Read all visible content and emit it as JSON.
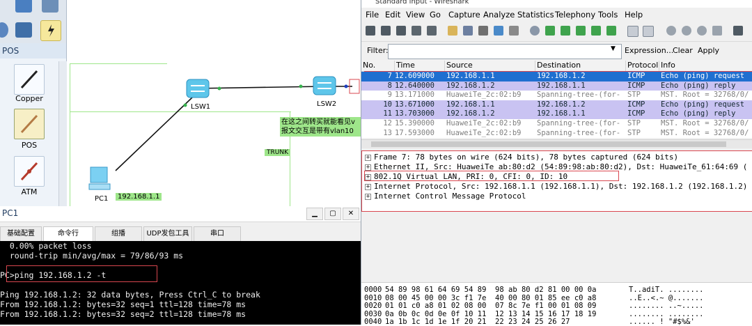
{
  "ensp": {
    "device_panel": {
      "category_title": "POS",
      "devices": [
        {
          "label": "Copper",
          "icon": "copper-cable-icon"
        },
        {
          "label": "POS",
          "icon": "pos-cable-icon"
        },
        {
          "label": "ATM",
          "icon": "atm-cable-icon"
        }
      ]
    },
    "topology": {
      "lsw1_label": "LSW1",
      "lsw2_label": "LSW2",
      "pc1_label": "PC1",
      "pc1_ip": "192.168.1.1",
      "trunk_label": "TRUNK",
      "note_line1": "在这之间转买就能看见v",
      "note_line2": "报文交互是带有vlan10"
    },
    "pc1_window": {
      "title": "PC1",
      "tabs": [
        "基础配置",
        "命令行",
        "组播",
        "UDP发包工具",
        "串口"
      ],
      "active_tab": "命令行",
      "console_lines": [
        "  0.00% packet loss",
        "  round-trip min/avg/max = 79/86/93 ms",
        "",
        "PC>ping 192.168.1.2 -t",
        "",
        "Ping 192.168.1.2: 32 data bytes, Press Ctrl_C to break",
        "From 192.168.1.2: bytes=32 seq=1 ttl=128 time=78 ms",
        "From 192.168.1.2: bytes=32 seq=2 ttl=128 time=78 ms"
      ]
    }
  },
  "wireshark": {
    "title": "Standard input - Wireshark",
    "menu": [
      "File",
      "Edit",
      "View",
      "Go",
      "Capture",
      "Analyze",
      "Statistics",
      "Telephony",
      "Tools",
      "Help"
    ],
    "filter": {
      "label": "Filter:",
      "value": "",
      "expression_label": "Expression...",
      "clear_label": "Clear",
      "apply_label": "Apply"
    },
    "columns": [
      "No.",
      "Time",
      "Source",
      "Destination",
      "Protocol",
      "Info"
    ],
    "packets": [
      {
        "no": "7",
        "time": "12.609000",
        "src": "192.168.1.1",
        "dst": "192.168.1.2",
        "proto": "ICMP",
        "info": "Echo (ping) request",
        "style": "selected"
      },
      {
        "no": "8",
        "time": "12.640000",
        "src": "192.168.1.2",
        "dst": "192.168.1.1",
        "proto": "ICMP",
        "info": "Echo (ping) reply",
        "style": "icmp"
      },
      {
        "no": "9",
        "time": "13.171000",
        "src": "HuaweiTe_2c:02:b9",
        "dst": "Spanning-tree-(for-",
        "proto": "STP",
        "info": "MST. Root = 32768/0/",
        "style": "stp"
      },
      {
        "no": "10",
        "time": "13.671000",
        "src": "192.168.1.1",
        "dst": "192.168.1.2",
        "proto": "ICMP",
        "info": "Echo (ping) request",
        "style": "icmp"
      },
      {
        "no": "11",
        "time": "13.703000",
        "src": "192.168.1.2",
        "dst": "192.168.1.1",
        "proto": "ICMP",
        "info": "Echo (ping) reply",
        "style": "icmp"
      },
      {
        "no": "12",
        "time": "15.390000",
        "src": "HuaweiTe_2c:02:b9",
        "dst": "Spanning-tree-(for-",
        "proto": "STP",
        "info": "MST. Root = 32768/0/",
        "style": "stp"
      },
      {
        "no": "13",
        "time": "17.593000",
        "src": "HuaweiTe_2c:02:b9",
        "dst": "Spanning-tree-(for-",
        "proto": "STP",
        "info": "MST. Root = 32768/0/",
        "style": "stp"
      }
    ],
    "details": [
      "Frame 7: 78 bytes on wire (624 bits), 78 bytes captured (624 bits)",
      "Ethernet II, Src: HuaweiTe_ab:80:d2 (54:89:98:ab:80:d2), Dst: HuaweiTe_61:64:69 (",
      "802.1Q Virtual LAN, PRI: 0, CFI: 0, ID: 10",
      "Internet Protocol, Src: 192.168.1.1 (192.168.1.1), Dst: 192.168.1.2 (192.168.1.2)",
      "Internet Control Message Protocol"
    ],
    "hex": [
      {
        "off": "0000",
        "bytes": "54 89 98 61 64 69 54 89  98 ab 80 d2 81 00 00 0a",
        "ascii": "T..adiT. ........"
      },
      {
        "off": "0010",
        "bytes": "08 00 45 00 00 3c f1 7e  40 00 80 01 85 ee c0 a8",
        "ascii": "..E..<.~ @......."
      },
      {
        "off": "0020",
        "bytes": "01 01 c0 a8 01 02 08 00  07 8c 7e f1 00 01 08 09",
        "ascii": "........ ..~....."
      },
      {
        "off": "0030",
        "bytes": "0a 0b 0c 0d 0e 0f 10 11  12 13 14 15 16 17 18 19",
        "ascii": "........ ........"
      },
      {
        "off": "0040",
        "bytes": "1a 1b 1c 1d 1e 1f 20 21  22 23 24 25 26 27",
        "ascii": "...... ! \"#$%&'"
      }
    ]
  }
}
